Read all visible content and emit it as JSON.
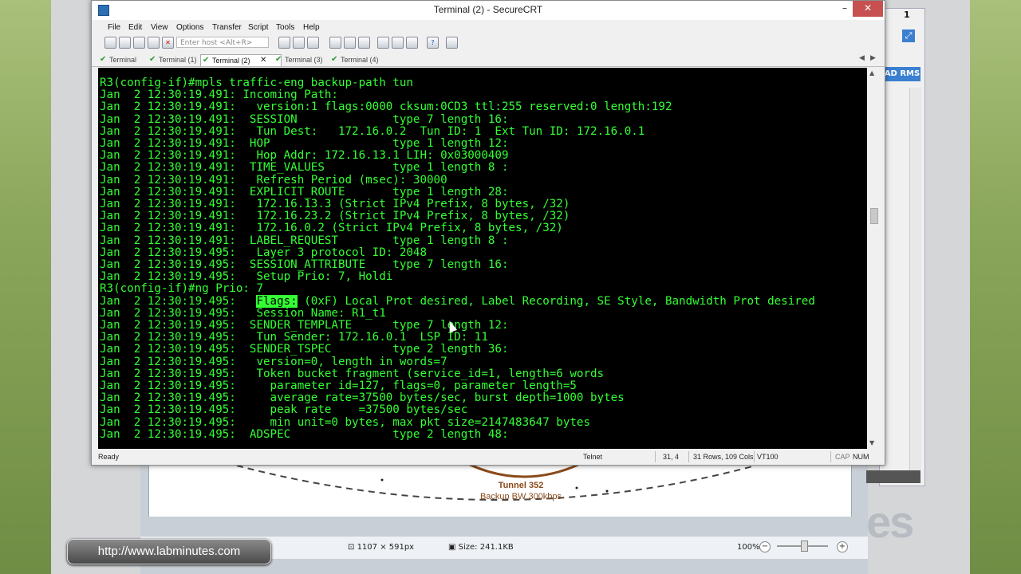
{
  "window": {
    "title": "Terminal (2) - SecureCRT"
  },
  "window_controls": {
    "minimize": "–",
    "maximize": "□",
    "close": "✕"
  },
  "menu": [
    "File",
    "Edit",
    "View",
    "Options",
    "Transfer",
    "Script",
    "Tools",
    "Help"
  ],
  "toolbar": {
    "host_placeholder": "Enter host <Alt+R>"
  },
  "tabs": [
    {
      "label": "Terminal",
      "active": false
    },
    {
      "label": "Terminal (1)",
      "active": false
    },
    {
      "label": "Terminal (2)",
      "active": true
    },
    {
      "label": "Terminal (3)",
      "active": false
    },
    {
      "label": "Terminal (4)",
      "active": false
    }
  ],
  "terminal": {
    "lines": [
      "R3(config-if)#mpls traffic-eng backup-path tun",
      "Jan  2 12:30:19.491: Incoming Path:",
      "Jan  2 12:30:19.491:   version:1 flags:0000 cksum:0CD3 ttl:255 reserved:0 length:192",
      "Jan  2 12:30:19.491:  SESSION              type 7 length 16:",
      "Jan  2 12:30:19.491:   Tun Dest:   172.16.0.2  Tun ID: 1  Ext Tun ID: 172.16.0.1",
      "Jan  2 12:30:19.491:  HOP                  type 1 length 12:",
      "Jan  2 12:30:19.491:   Hop Addr: 172.16.13.1 LIH: 0x03000409",
      "Jan  2 12:30:19.491:  TIME_VALUES          type 1 length 8 :",
      "Jan  2 12:30:19.491:   Refresh Period (msec): 30000",
      "Jan  2 12:30:19.491:  EXPLICIT_ROUTE       type 1 length 28:",
      "Jan  2 12:30:19.491:   172.16.13.3 (Strict IPv4 Prefix, 8 bytes, /32)",
      "Jan  2 12:30:19.491:   172.16.23.2 (Strict IPv4 Prefix, 8 bytes, /32)",
      "Jan  2 12:30:19.491:   172.16.0.2 (Strict IPv4 Prefix, 8 bytes, /32)",
      "Jan  2 12:30:19.491:  LABEL_REQUEST        type 1 length 8 :",
      "Jan  2 12:30:19.495:   Layer 3 protocol ID: 2048",
      "Jan  2 12:30:19.495:  SESSION_ATTRIBUTE    type 7 length 16:",
      "Jan  2 12:30:19.495:   Setup Prio: 7, Holdi",
      "R3(config-if)#ng Prio: 7",
      "Jan  2 12:30:19.495:   ",
      "Jan  2 12:30:19.495:   Session Name: R1_t1",
      "Jan  2 12:30:19.495:  SENDER_TEMPLATE      type 7 length 12:",
      "Jan  2 12:30:19.495:   Tun Sender: 172.16.0.1  LSP ID: 11",
      "Jan  2 12:30:19.495:  SENDER_TSPEC         type 2 length 36:",
      "Jan  2 12:30:19.495:   version=0, length in words=7",
      "Jan  2 12:30:19.495:   Token bucket fragment (service_id=1, length=6 words",
      "Jan  2 12:30:19.495:     parameter id=127, flags=0, parameter length=5",
      "Jan  2 12:30:19.495:     average rate=37500 bytes/sec, burst depth=1000 bytes",
      "Jan  2 12:30:19.495:     peak rate    =37500 bytes/sec",
      "Jan  2 12:30:19.495:     min unit=0 bytes, max pkt size=2147483647 bytes",
      "Jan  2 12:30:19.495:  ADSPEC               type 2 length 48:"
    ],
    "highlight_word": "Flags:",
    "highlight_rest": " (0xF) Local Prot desired, Label Recording, SE Style, Bandwidth Prot desired"
  },
  "status_bar": {
    "ready": "Ready",
    "protocol": "Telnet",
    "cursor_pos": "31,  4",
    "size": "31 Rows, 109 Cols",
    "emulation": "VT100",
    "cap": "CAP",
    "num": "NUM"
  },
  "background_viewer": {
    "tunnel_label": "Tunnel 352",
    "tunnel_sub": "Backup BW 300kbps",
    "dimensions": "1107 × 591px",
    "file_size": "Size: 241.1KB",
    "zoom": "100%"
  },
  "side_window": {
    "button_label": "AD RMS",
    "badge": "1"
  },
  "watermark": {
    "url": "http://www.labminutes.com",
    "logo_fragment": "es"
  },
  "colors": {
    "terminal_fg": "#34ff34",
    "terminal_bg": "#000000",
    "close_btn": "#c75050",
    "accent": "#3a7fd0"
  }
}
